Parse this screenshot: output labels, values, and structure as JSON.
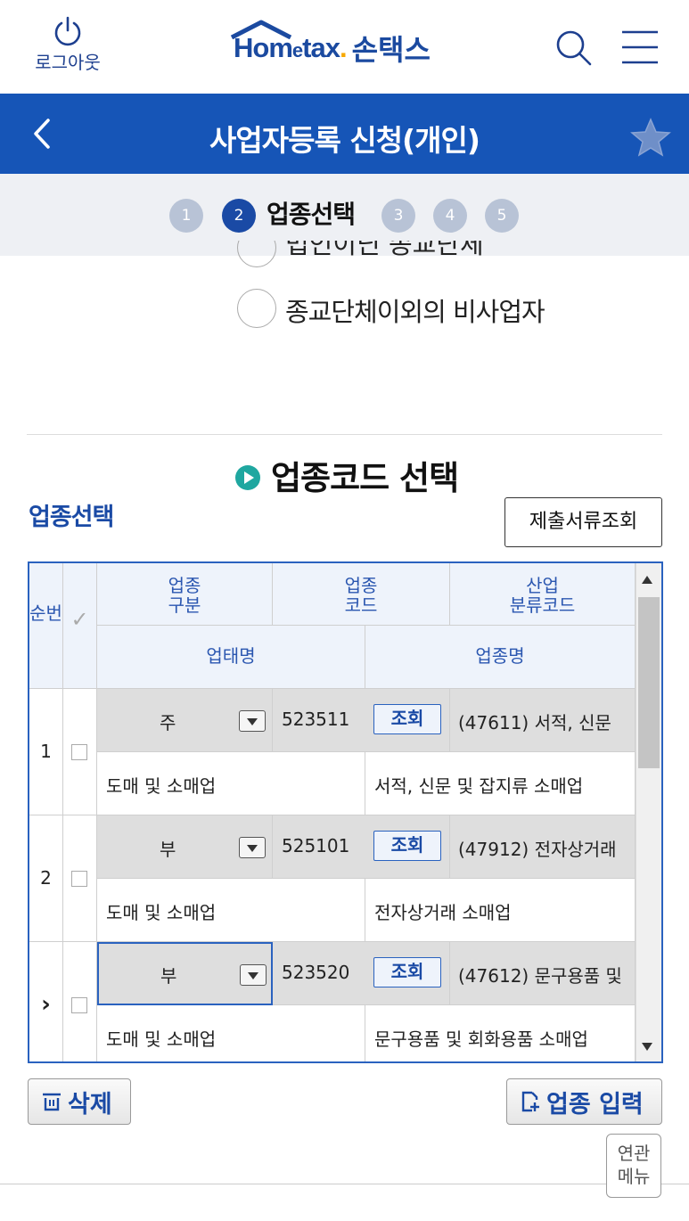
{
  "header": {
    "logout_label": "로그아웃",
    "logo_home": "Hom",
    "logo_e": "e",
    "logo_tax": "tax",
    "logo_dot": ".",
    "logo_kor": "손택스"
  },
  "titlebar": {
    "title": "사업자등록 신청(개인)"
  },
  "steps": {
    "items": [
      "1",
      "2",
      "3",
      "4",
      "5"
    ],
    "active_label": "업종선택"
  },
  "form": {
    "partial_option": "법인이닌 종교단체",
    "option_label": "종교단체이외의 비사업자"
  },
  "section": {
    "title": "업종코드 선택",
    "sub_title": "업종선택",
    "doc_button": "제출서류조회"
  },
  "grid": {
    "headers": {
      "seq": "순번",
      "check": "✓",
      "type": "업종\n구분",
      "code": "업종\n코드",
      "industry_code": "산업\n분류코드",
      "business_name": "업태명",
      "industry_name": "업종명"
    },
    "lookup_label": "조회",
    "rows": [
      {
        "seq": "1",
        "type": "주",
        "code": "523511",
        "industry": "(47611) 서적, 신문",
        "business": "도매 및 소매업",
        "name": "서적, 신문 및 잡지류 소매업"
      },
      {
        "seq": "2",
        "type": "부",
        "code": "525101",
        "industry": "(47912) 전자상거래",
        "business": "도매 및 소매업",
        "name": "전자상거래 소매업"
      },
      {
        "seq": "›",
        "type": "부",
        "code": "523520",
        "industry": "(47612) 문구용품 및",
        "business": "도매 및 소매업",
        "name": "문구용품 및 회화용품 소매업"
      }
    ]
  },
  "buttons": {
    "delete": "삭제",
    "add": "업종 입력",
    "related_line1": "연관",
    "related_line2": "메뉴"
  },
  "colors": {
    "primary": "#1655b7",
    "accent": "#1fa7a0",
    "step_inactive": "#b8c3d6"
  }
}
